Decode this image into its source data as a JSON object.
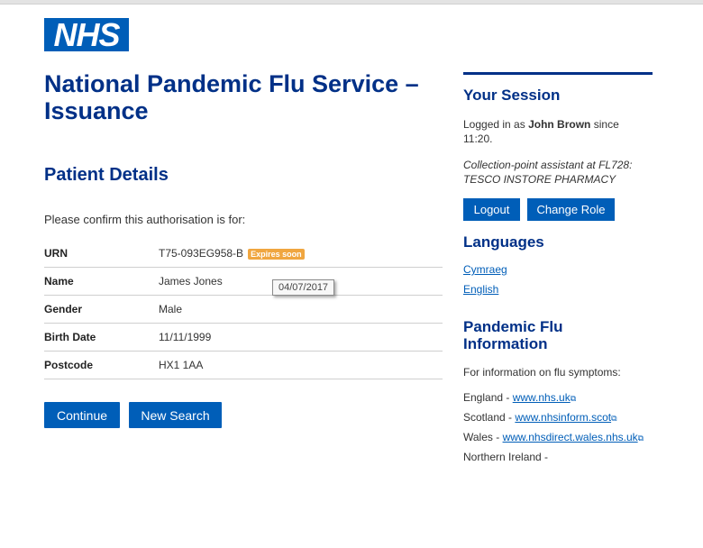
{
  "brand": {
    "logo_text": "NHS"
  },
  "page": {
    "title": "National Pandemic Flu Service – Issuance",
    "section_title": "Patient Details",
    "intro": "Please confirm this authorisation is for:"
  },
  "patient": {
    "rows": [
      {
        "label": "URN",
        "value": "T75-093EG958-B",
        "badge": "Expires soon"
      },
      {
        "label": "Name",
        "value": "James Jones"
      },
      {
        "label": "Gender",
        "value": "Male"
      },
      {
        "label": "Birth Date",
        "value": "11/11/1999"
      },
      {
        "label": "Postcode",
        "value": "HX1 1AA"
      }
    ],
    "tooltip": "04/07/2017"
  },
  "actions": {
    "continue": "Continue",
    "new_search": "New Search"
  },
  "session": {
    "heading": "Your Session",
    "logged_prefix": "Logged in as ",
    "user": "John Brown",
    "since": " since 11:20.",
    "role": "Collection-point assistant at FL728: TESCO INSTORE PHARMACY",
    "logout": "Logout",
    "change_role": "Change Role"
  },
  "languages": {
    "heading": "Languages",
    "items": [
      "Cymraeg",
      "English"
    ]
  },
  "info": {
    "heading": "Pandemic Flu Information",
    "intro": "For information on flu symptoms:",
    "links": [
      {
        "region": "England - ",
        "url": "www.nhs.uk"
      },
      {
        "region": "Scotland - ",
        "url": "www.nhsinform.scot"
      },
      {
        "region": "Wales - ",
        "url": "www.nhsdirect.wales.nhs.uk"
      }
    ],
    "last_region": "Northern Ireland -"
  },
  "colors": {
    "nhs_blue": "#005eb8",
    "dark_blue": "#003087",
    "badge": "#f0a640"
  },
  "icons": {
    "external_link": "external-link-icon"
  }
}
